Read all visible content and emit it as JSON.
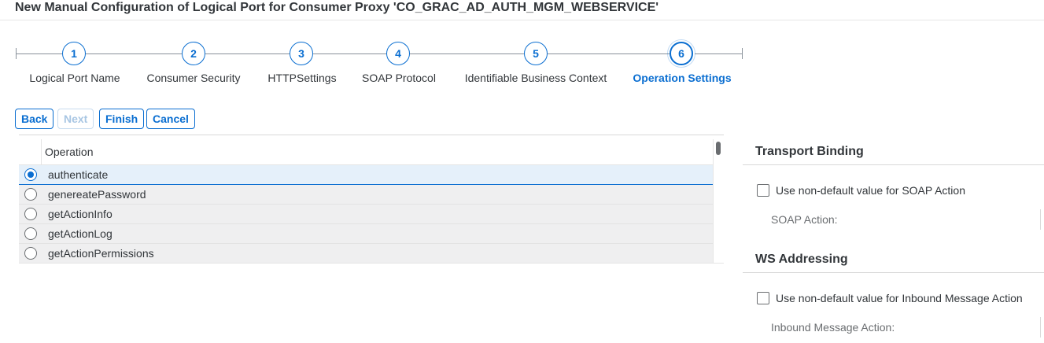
{
  "title": "New Manual Configuration of Logical Port for Consumer Proxy 'CO_GRAC_AD_AUTH_MGM_WEBSERVICE'",
  "wizard": {
    "steps": [
      {
        "number": "1",
        "label": "Logical Port Name"
      },
      {
        "number": "2",
        "label": "Consumer Security"
      },
      {
        "number": "3",
        "label": "HTTPSettings"
      },
      {
        "number": "4",
        "label": "SOAP Protocol"
      },
      {
        "number": "5",
        "label": "Identifiable Business Context"
      },
      {
        "number": "6",
        "label": "Operation Settings"
      }
    ],
    "active_step": 6
  },
  "toolbar": {
    "back_label": "Back",
    "next_label": "Next",
    "finish_label": "Finish",
    "cancel_label": "Cancel"
  },
  "table": {
    "header": "Operation",
    "rows": [
      {
        "name": "authenticate",
        "selected": true
      },
      {
        "name": "genereatePassword",
        "selected": false
      },
      {
        "name": "getActionInfo",
        "selected": false
      },
      {
        "name": "getActionLog",
        "selected": false
      },
      {
        "name": "getActionPermissions",
        "selected": false
      }
    ]
  },
  "transport_binding": {
    "title": "Transport Binding",
    "checkbox_label": "Use non-default value for SOAP Action",
    "field_label": "SOAP Action:"
  },
  "ws_addressing": {
    "title": "WS Addressing",
    "checkbox_label": "Use non-default value for Inbound Message Action",
    "field_label": "Inbound Message Action:"
  },
  "colors": {
    "accent": "#0a6ed1",
    "selected_row": "#e5f0fa",
    "row_bg": "#efeff0"
  }
}
